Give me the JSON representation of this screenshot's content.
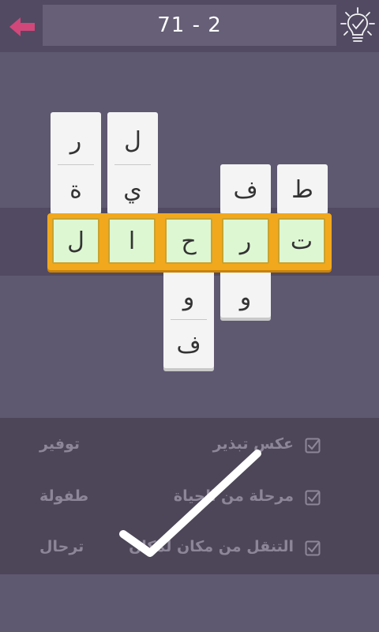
{
  "header": {
    "level_label": "71 - 2",
    "back_icon": "arrow-left-icon",
    "hint_icon": "lightbulb-check-icon",
    "accent_color": "#d1477a"
  },
  "puzzle": {
    "answer_tiles": [
      "ل",
      "ا",
      "ح",
      "ر",
      "ت"
    ],
    "column_1": {
      "above": [
        "ر",
        "ة"
      ],
      "below": []
    },
    "column_2": {
      "above": [
        "ل",
        "ي"
      ],
      "below": []
    },
    "column_3": {
      "above": [],
      "below": [
        "و",
        "ف"
      ]
    },
    "column_4": {
      "above": [
        "ف"
      ],
      "below": [
        "و"
      ]
    },
    "column_5": {
      "above": [
        "ط"
      ],
      "below": []
    },
    "strip_color": "#f2a81c",
    "tile_color": "#ddf7d2"
  },
  "clues": [
    {
      "text": "عكس تبذير",
      "answer": "توفير"
    },
    {
      "text": "مرحلة من الحياة",
      "answer": "طفولة"
    },
    {
      "text": "التنقل من مكان لمكان",
      "answer": "ترحال"
    }
  ],
  "overlay": {
    "icon": "success-checkmark-icon"
  }
}
